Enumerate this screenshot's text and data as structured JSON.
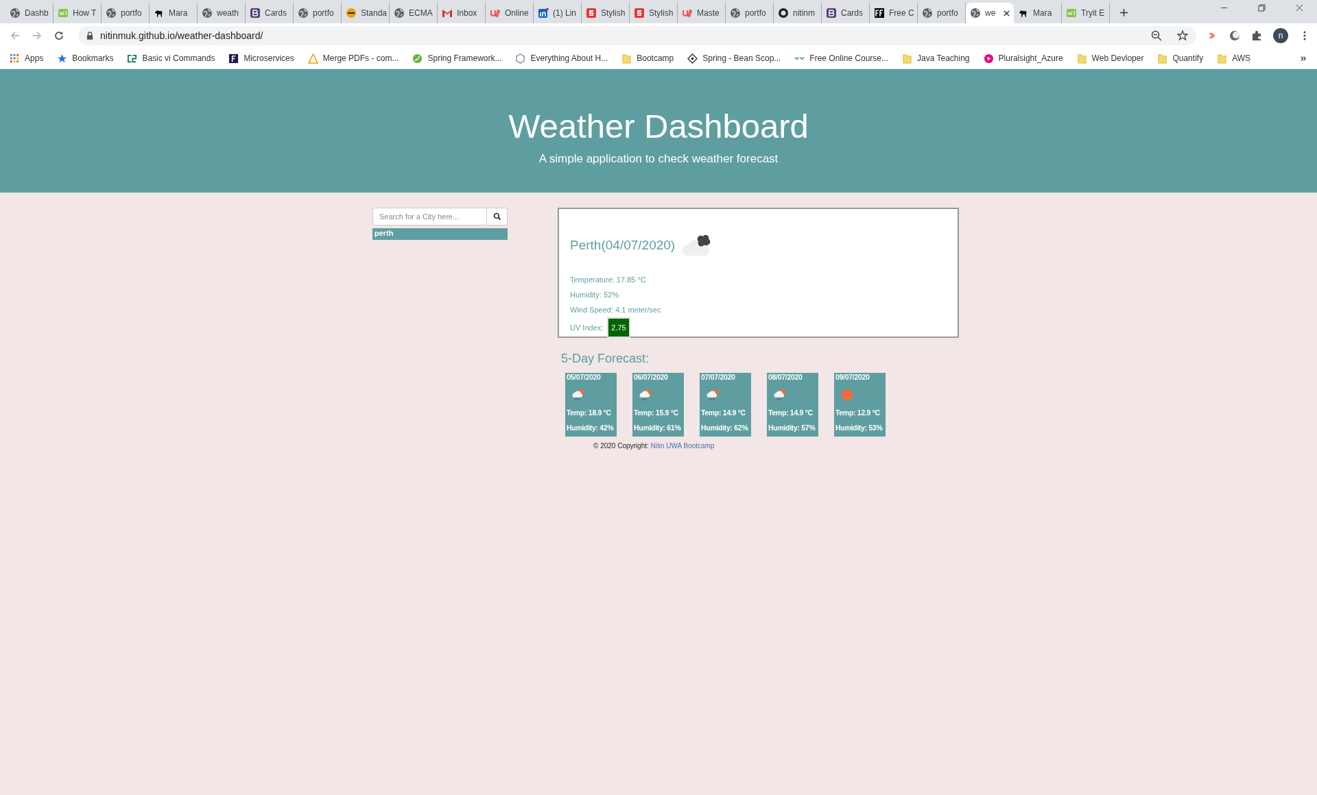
{
  "browser": {
    "tabs": [
      {
        "label": "Dashb",
        "kind": "globe",
        "selected": false
      },
      {
        "label": "How T",
        "kind": "w3",
        "selected": false
      },
      {
        "label": "portfo",
        "kind": "globe",
        "selected": false
      },
      {
        "label": "Mara",
        "kind": "dog",
        "selected": false
      },
      {
        "label": "weath",
        "kind": "globe",
        "selected": false
      },
      {
        "label": "Cards",
        "kind": "bootstrap",
        "selected": false
      },
      {
        "label": "portfo",
        "kind": "globe",
        "selected": false
      },
      {
        "label": "Standa",
        "kind": "ecma",
        "selected": false
      },
      {
        "label": "ECMA",
        "kind": "globe",
        "selected": false
      },
      {
        "label": "Inbox",
        "kind": "gmail",
        "selected": false
      },
      {
        "label": "Online",
        "kind": "udemy",
        "selected": false
      },
      {
        "label": "(1) Lin",
        "kind": "linkedin",
        "selected": false
      },
      {
        "label": "Stylish",
        "kind": "stylish",
        "selected": false
      },
      {
        "label": "Stylish",
        "kind": "stylish",
        "selected": false
      },
      {
        "label": "Maste",
        "kind": "udemy",
        "selected": false
      },
      {
        "label": "portfo",
        "kind": "globe",
        "selected": false
      },
      {
        "label": "nitinm",
        "kind": "github",
        "selected": false
      },
      {
        "label": "Cards",
        "kind": "bootstrap",
        "selected": false
      },
      {
        "label": "Free C",
        "kind": "ff",
        "selected": false
      },
      {
        "label": "portfo",
        "kind": "globe",
        "selected": false
      },
      {
        "label": "we",
        "kind": "globe",
        "selected": true
      },
      {
        "label": "Mara",
        "kind": "dog",
        "selected": false
      },
      {
        "label": "Tryit E",
        "kind": "w3",
        "selected": false
      }
    ],
    "url": "nitinmuk.github.io/weather-dashboard/",
    "profile_initial": "n",
    "bookmarks": [
      {
        "label": "Apps",
        "kind": "apps"
      },
      {
        "label": "Bookmarks",
        "kind": "star"
      },
      {
        "label": "Basic vi Commands",
        "kind": "cs"
      },
      {
        "label": "Microservices",
        "kind": "dark-square"
      },
      {
        "label": "Merge PDFs - com...",
        "kind": "warning"
      },
      {
        "label": "Spring Framework...",
        "kind": "spring"
      },
      {
        "label": "Everything About H...",
        "kind": "hex"
      },
      {
        "label": "Bootcamp",
        "kind": "folder"
      },
      {
        "label": "Spring - Bean Scop...",
        "kind": "diamond"
      },
      {
        "label": "Free Online Course...",
        "kind": "chevrons"
      },
      {
        "label": "Java Teaching",
        "kind": "folder"
      },
      {
        "label": "Pluralsight_Azure",
        "kind": "pluralsight"
      },
      {
        "label": "Web Devloper",
        "kind": "folder"
      },
      {
        "label": "Quantify",
        "kind": "folder"
      },
      {
        "label": "AWS",
        "kind": "folder"
      }
    ]
  },
  "header": {
    "title": "Weather Dashboard",
    "subtitle": "A simple application to check weather forecast"
  },
  "search": {
    "placeholder": "Search for a City here..."
  },
  "history": [
    {
      "label": "perth"
    }
  ],
  "current": {
    "title": "Perth(04/07/2020)",
    "kind": "dark-clouds",
    "temperature": "Temperature: 17.85 °C",
    "humidity": "Humidity: 52%",
    "wind": "Wind Speed: 4.1 meter/sec",
    "uv_label": "UV Index:",
    "uv_value": "2.75"
  },
  "forecast_title": "5-Day Forecast:",
  "forecast": [
    {
      "date": "05/07/2020",
      "kind": "rain-sun",
      "temp": "Temp: 18.9 °C",
      "humidity": "Humidity: 42%"
    },
    {
      "date": "06/07/2020",
      "kind": "rain-sun",
      "temp": "Temp: 15.9 °C",
      "humidity": "Humidity: 61%"
    },
    {
      "date": "07/07/2020",
      "kind": "rain-sun",
      "temp": "Temp: 14.9 °C",
      "humidity": "Humidity: 62%"
    },
    {
      "date": "08/07/2020",
      "kind": "rain-sun",
      "temp": "Temp: 14.9 °C",
      "humidity": "Humidity: 57%"
    },
    {
      "date": "09/07/2020",
      "kind": "sun",
      "temp": "Temp: 12.9 °C",
      "humidity": "Humidity: 53%"
    }
  ],
  "footer": {
    "text": "© 2020 Copyright:",
    "link": "Nitin UWA Bootcamp"
  }
}
